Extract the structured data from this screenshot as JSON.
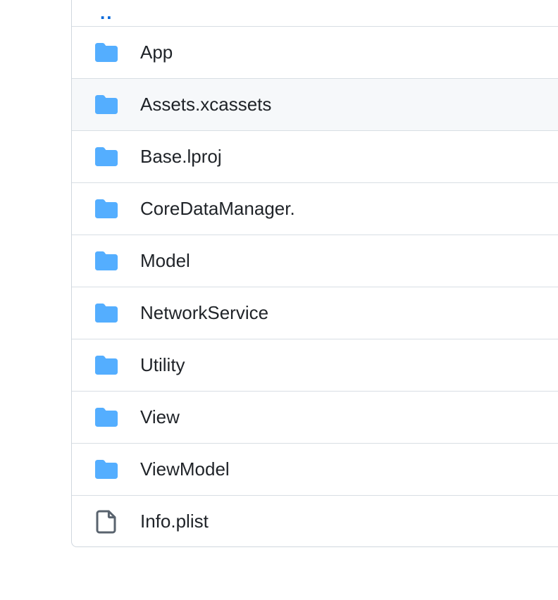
{
  "parent_link": "..",
  "colors": {
    "folder": "#54aeff",
    "file": "#59636e",
    "link": "#0969da",
    "hover_row": "#f6f8fa"
  },
  "rows": [
    {
      "name": "App",
      "icon": "folder-icon"
    },
    {
      "name": "Assets.xcassets",
      "icon": "folder-icon"
    },
    {
      "name": "Base.lproj",
      "icon": "folder-icon"
    },
    {
      "name": "CoreDataManager.",
      "icon": "folder-icon"
    },
    {
      "name": "Model",
      "icon": "folder-icon"
    },
    {
      "name": "NetworkService",
      "icon": "folder-icon"
    },
    {
      "name": "Utility",
      "icon": "folder-icon"
    },
    {
      "name": "View",
      "icon": "folder-icon"
    },
    {
      "name": "ViewModel",
      "icon": "folder-icon"
    },
    {
      "name": "Info.plist",
      "icon": "file-icon"
    }
  ]
}
